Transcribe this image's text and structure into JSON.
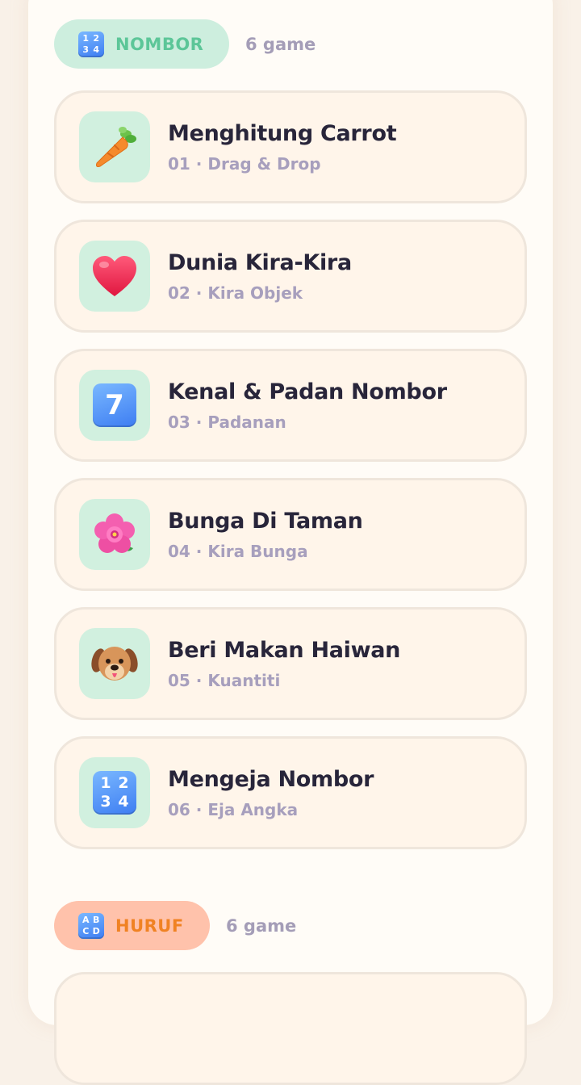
{
  "sections": [
    {
      "label": "NOMBOR",
      "count": "6 game",
      "icon": "numbers-keycap-icon",
      "color": "#5cc698",
      "games": [
        {
          "title": "Menghitung Carrot",
          "subtitle": "01 · Drag & Drop",
          "icon": "carrot-icon"
        },
        {
          "title": "Dunia Kira-Kira",
          "subtitle": "02 · Kira Objek",
          "icon": "heart-icon"
        },
        {
          "title": "Kenal & Padan Nombor",
          "subtitle": "03 · Padanan",
          "icon": "keycap-seven-icon"
        },
        {
          "title": "Bunga Di Taman",
          "subtitle": "04 · Kira Bunga",
          "icon": "hibiscus-icon"
        },
        {
          "title": "Beri Makan Haiwan",
          "subtitle": "05 · Kuantiti",
          "icon": "dog-face-icon"
        },
        {
          "title": "Mengeja Nombor",
          "subtitle": "06 · Eja Angka",
          "icon": "numbers-keycap-icon"
        }
      ]
    },
    {
      "label": "HURUF",
      "count": "6 game",
      "icon": "abcd-keycap-icon",
      "color": "#f08223"
    }
  ],
  "glyphs": {
    "numbers": [
      "1",
      "2",
      "3",
      "4"
    ],
    "letters": [
      "A",
      "B",
      "C",
      "D"
    ],
    "seven": "7"
  }
}
